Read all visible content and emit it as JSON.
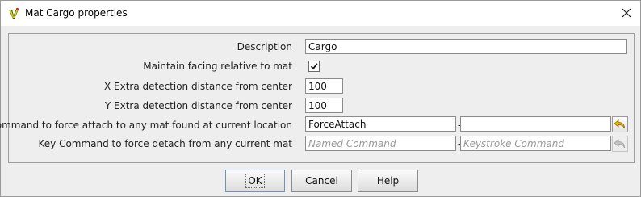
{
  "window": {
    "title": "Mat Cargo properties"
  },
  "form": {
    "description": {
      "label": "Description",
      "value": "Cargo"
    },
    "maintain_facing": {
      "label": "Maintain facing relative to mat",
      "checked": true
    },
    "x_extra": {
      "label": "X Extra detection distance from center",
      "value": "100"
    },
    "y_extra": {
      "label": "Y Extra detection distance from center",
      "value": "100"
    },
    "attach_key": {
      "label": "Key Command to force attach to any mat found at current location",
      "named_value": "ForceAttach",
      "keystroke_value": "",
      "separator": "-"
    },
    "detach_key": {
      "label": "Key Command to force detach from any current mat",
      "named_placeholder": "Named Command",
      "keystroke_placeholder": "Keystroke Command",
      "separator": "-"
    }
  },
  "buttons": {
    "ok": "OK",
    "cancel": "Cancel",
    "help": "Help"
  },
  "colors": {
    "undo_icon": "#e8b400",
    "undo_icon_disabled": "#b5b5b5",
    "panel_bg": "#eeeeee"
  }
}
